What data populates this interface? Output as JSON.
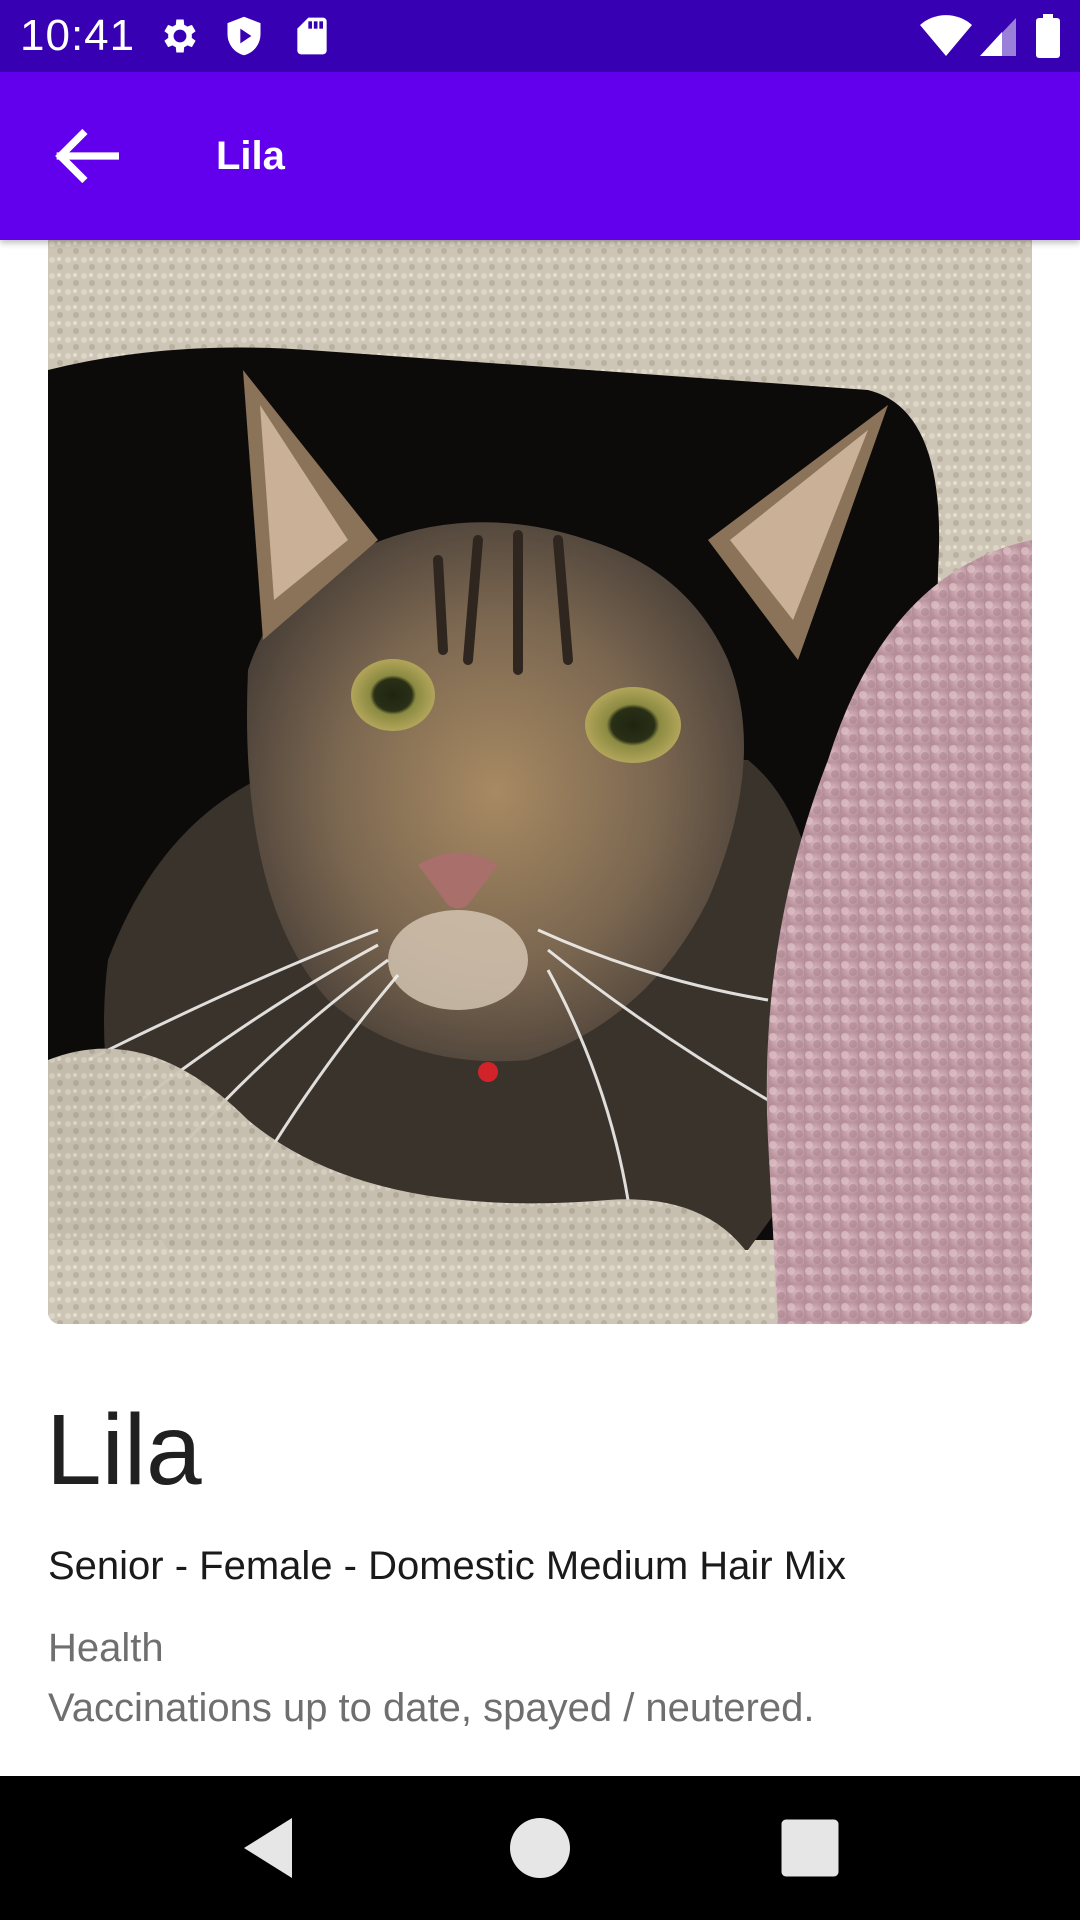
{
  "status_bar": {
    "time": "10:41",
    "left_icons": [
      "gear-icon",
      "shield-play-icon",
      "sd-card-icon"
    ],
    "right_icons": [
      "wifi-icon",
      "cell-signal-icon",
      "battery-icon"
    ]
  },
  "app_bar": {
    "title": "Lila",
    "back_icon": "arrow-back-icon"
  },
  "pet": {
    "photo": "cat-photo",
    "name": "Lila",
    "summary": "Senior - Female - Domestic Medium Hair Mix",
    "health_label": "Health",
    "health_text": "Vaccinations up to date, spayed / neutered."
  },
  "nav_bar": {
    "back_icon": "nav-back-icon",
    "home_icon": "nav-home-icon",
    "recents_icon": "nav-recents-icon"
  },
  "colors": {
    "status_bar": "#3700b3",
    "app_bar": "#6200ee",
    "nav_bar": "#000000",
    "secondary_text": "#6f6f6f"
  }
}
